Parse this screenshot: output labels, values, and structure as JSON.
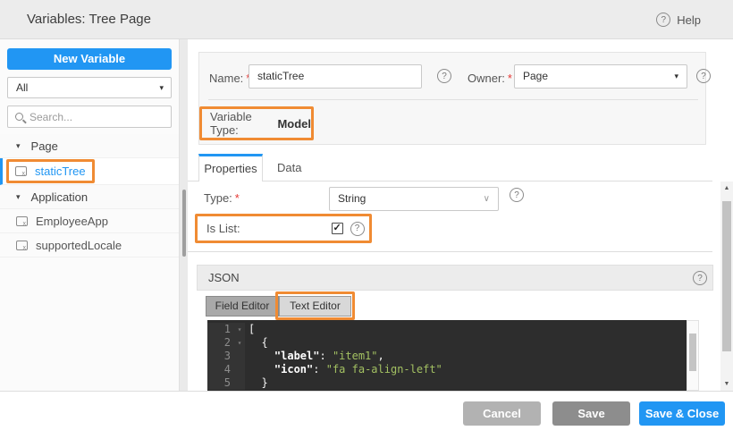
{
  "header": {
    "title": "Variables: Tree Page",
    "help_label": "Help"
  },
  "icons": {
    "help": "?",
    "caret_down": "▾",
    "chevron_down": "∨",
    "scroll_up": "▲",
    "scroll_down": "▼",
    "check": "✓"
  },
  "sidebar": {
    "new_variable_label": "New Variable",
    "filter_value": "All",
    "search_placeholder": "Search...",
    "tree": [
      {
        "type": "group",
        "label": "Page"
      },
      {
        "type": "item",
        "label": "staticTree",
        "selected": true,
        "highlighted": true
      },
      {
        "type": "group",
        "label": "Application"
      },
      {
        "type": "item",
        "label": "EmployeeApp"
      },
      {
        "type": "item",
        "label": "supportedLocale"
      }
    ]
  },
  "form": {
    "required_marker": "*",
    "name_label": "Name:",
    "name_value": "staticTree",
    "owner_label": "Owner:",
    "owner_value": "Page",
    "variable_type_label": "Variable Type:",
    "variable_type_value": "Model"
  },
  "tabs": {
    "properties": "Properties",
    "data": "Data"
  },
  "properties": {
    "type_label": "Type:",
    "type_value": "String",
    "is_list_label": "Is List:",
    "is_list_checked": true
  },
  "json_section": {
    "title": "JSON",
    "field_editor_label": "Field Editor",
    "text_editor_label": "Text Editor",
    "code_lines": {
      "l1": {
        "num": "1",
        "fold": "▾",
        "text": "["
      },
      "l2": {
        "num": "2",
        "fold": "▾",
        "text": "  {"
      },
      "l3": {
        "num": "3",
        "fold": "",
        "indent": "    ",
        "key": "\"label\"",
        "colon": ": ",
        "value": "\"item1\"",
        "tail": ","
      },
      "l4": {
        "num": "4",
        "fold": "",
        "indent": "    ",
        "key": "\"icon\"",
        "colon": ": ",
        "value": "\"fa fa-align-left\"",
        "tail": ""
      },
      "l5": {
        "num": "5",
        "fold": "",
        "text": "  }"
      }
    }
  },
  "footer": {
    "cancel_label": "Cancel",
    "save_label": "Save",
    "save_close_label": "Save & Close"
  },
  "colors": {
    "accent_blue": "#2196f3",
    "highlight_orange": "#f08b33",
    "code_string_green": "#a3c162",
    "header_bg": "#ececec",
    "editor_bg": "#2d2d2d"
  }
}
